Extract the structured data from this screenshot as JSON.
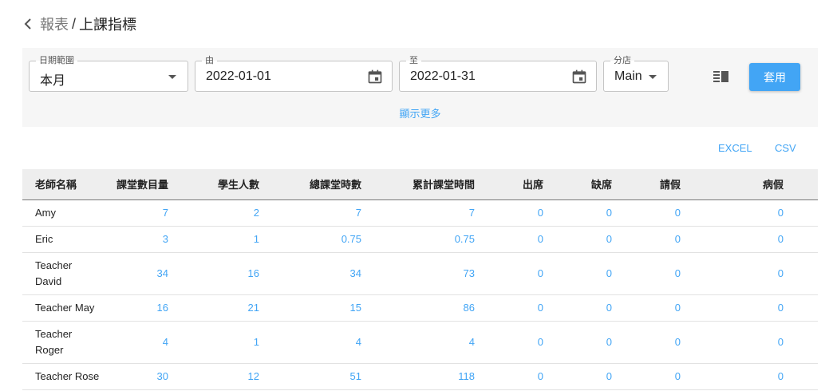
{
  "breadcrumb": {
    "parent": "報表",
    "separator": "/",
    "current": "上課指標"
  },
  "filters": {
    "date_range": {
      "label": "日期範圍",
      "value": "本月"
    },
    "from": {
      "label": "由",
      "value": "2022-01-01"
    },
    "to": {
      "label": "至",
      "value": "2022-01-31"
    },
    "branch": {
      "label": "分店",
      "value": "Main"
    },
    "apply_label": "套用",
    "more_label": "顯示更多"
  },
  "export": {
    "excel": "EXCEL",
    "csv": "CSV"
  },
  "table": {
    "headers": [
      "老師名稱",
      "課堂數目量",
      "學生人數",
      "總課堂時數",
      "累計課堂時間",
      "出席",
      "缺席",
      "請假",
      "病假"
    ],
    "rows": [
      [
        "Amy",
        "7",
        "2",
        "7",
        "7",
        "0",
        "0",
        "0",
        "0"
      ],
      [
        "Eric",
        "3",
        "1",
        "0.75",
        "0.75",
        "0",
        "0",
        "0",
        "0"
      ],
      [
        "Teacher David",
        "34",
        "16",
        "34",
        "73",
        "0",
        "0",
        "0",
        "0"
      ],
      [
        "Teacher May",
        "16",
        "21",
        "15",
        "86",
        "0",
        "0",
        "0",
        "0"
      ],
      [
        "Teacher Roger",
        "4",
        "1",
        "4",
        "4",
        "0",
        "0",
        "0",
        "0"
      ],
      [
        "Teacher Rose",
        "30",
        "12",
        "51",
        "118",
        "0",
        "0",
        "0",
        "0"
      ]
    ]
  },
  "colors": {
    "accent": "#42a5f5",
    "panel": "#f6f6f6",
    "header_bg": "#eeeeee"
  },
  "icons": {
    "back": "chevron-left-icon",
    "calendar": "calendar-icon",
    "columns": "columns-icon",
    "dropdown": "caret-down-icon"
  }
}
